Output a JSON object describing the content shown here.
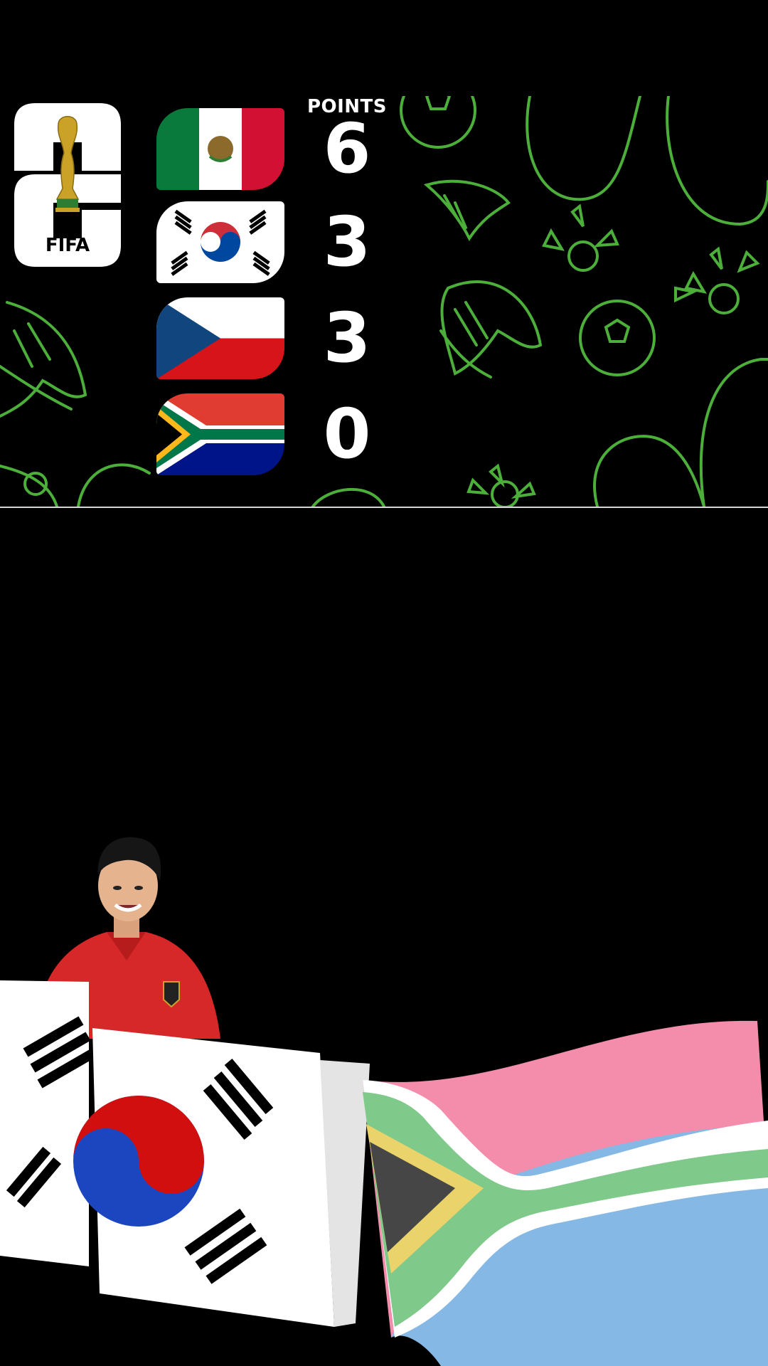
{
  "standings": {
    "points_header": "POINTS",
    "logo": {
      "mark": "26",
      "wordmark": "FIFA"
    },
    "teams": [
      {
        "team": "Mexico",
        "flag_icon": "mexico-flag-icon",
        "points": "6"
      },
      {
        "team": "South Korea",
        "flag_icon": "south-korea-flag-icon",
        "points": "3"
      },
      {
        "team": "Czechia",
        "flag_icon": "czechia-flag-icon",
        "points": "3"
      },
      {
        "team": "South Africa",
        "flag_icon": "south-africa-flag-icon",
        "points": "0"
      }
    ]
  },
  "colors": {
    "background": "#000000",
    "doodle_green": "#4caf3a",
    "text": "#ffffff"
  }
}
